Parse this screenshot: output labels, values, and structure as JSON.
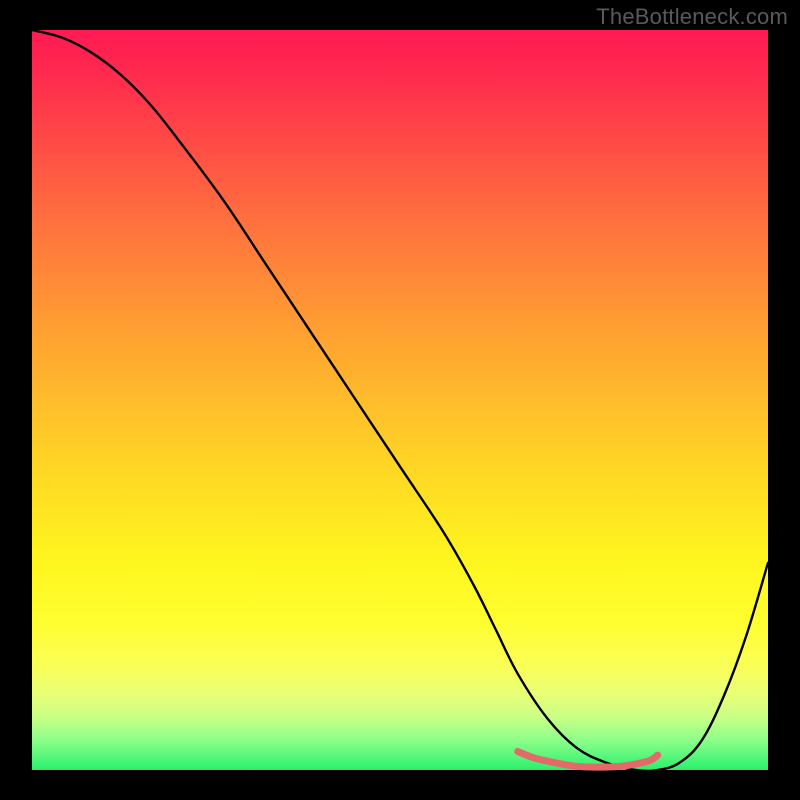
{
  "watermark": "TheBottleneck.com",
  "chart_data": {
    "type": "line",
    "title": "",
    "xlabel": "",
    "ylabel": "",
    "xlim": [
      0,
      100
    ],
    "ylim": [
      0,
      100
    ],
    "series": [
      {
        "name": "bottleneck-curve",
        "color": "#000000",
        "x": [
          0,
          4,
          8,
          12,
          16,
          20,
          26,
          32,
          38,
          44,
          50,
          56,
          60,
          63,
          66,
          70,
          74,
          78,
          82,
          85,
          88,
          91,
          94,
          97,
          100
        ],
        "y": [
          100,
          99,
          97,
          94,
          90,
          85,
          77,
          68,
          59,
          50,
          41,
          32,
          25,
          19,
          13,
          7,
          3,
          1,
          0,
          0,
          1,
          4,
          10,
          18,
          28
        ]
      },
      {
        "name": "highlight-segment",
        "color": "#e46a6a",
        "x": [
          66,
          68,
          70,
          72,
          74,
          76,
          78,
          80,
          82,
          84,
          85
        ],
        "y": [
          2.5,
          1.7,
          1.2,
          0.8,
          0.5,
          0.4,
          0.4,
          0.5,
          0.8,
          1.3,
          2.0
        ]
      }
    ],
    "gradient_stops": [
      {
        "pos": 0,
        "color": "#ff1a54"
      },
      {
        "pos": 50,
        "color": "#ffc828"
      },
      {
        "pos": 80,
        "color": "#fffe30"
      },
      {
        "pos": 100,
        "color": "#29f06e"
      }
    ]
  }
}
